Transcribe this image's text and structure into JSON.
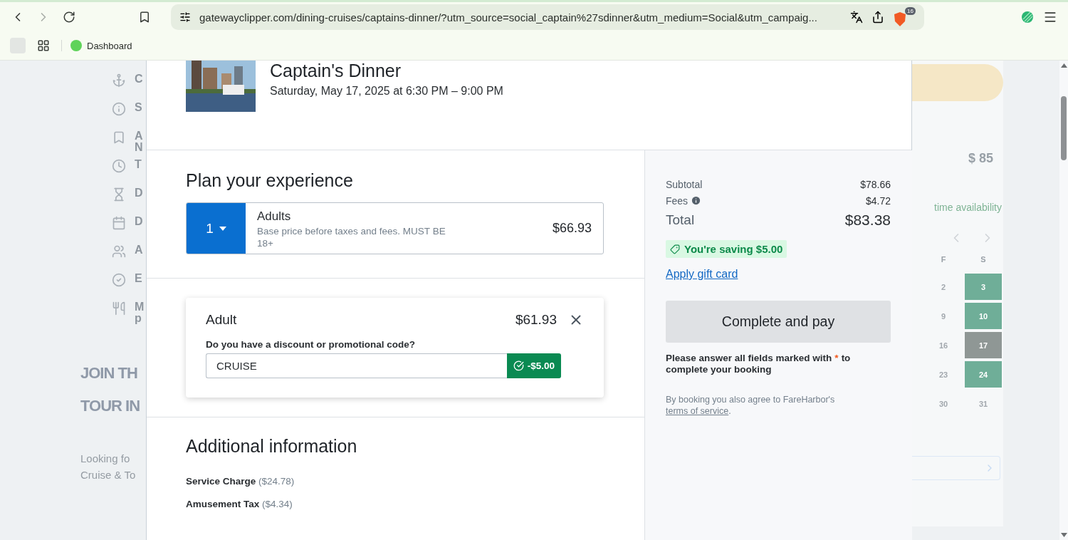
{
  "browser": {
    "url": "gatewayclipper.com/dining-cruises/captains-dinner/?utm_source=social_captain%27sdinner&utm_medium=Social&utm_campaig...",
    "shield_badge": "16",
    "bookmarks": [
      {
        "label": "Dashboard"
      }
    ]
  },
  "background_page": {
    "left_items": [
      {
        "lines": [
          "C"
        ]
      },
      {
        "lines": [
          "S"
        ]
      },
      {
        "lines": [
          "A",
          "N"
        ]
      },
      {
        "lines": [
          "T"
        ]
      },
      {
        "lines": [
          "D"
        ]
      },
      {
        "lines": [
          "D"
        ]
      },
      {
        "lines": [
          "A"
        ]
      },
      {
        "lines": [
          "E"
        ]
      },
      {
        "lines": [
          "M",
          "p"
        ]
      }
    ],
    "headline": [
      "JOIN TH",
      "TOUR IN"
    ],
    "intro": [
      "Looking fo",
      "Cruise & To"
    ],
    "price": "$ 85",
    "availability": "time availability",
    "calendar": {
      "headers": [
        "F",
        "S"
      ],
      "rows": [
        {
          "days": [
            {
              "day": "2",
              "available": false,
              "selected": false
            },
            {
              "day": "3",
              "available": true,
              "selected": false
            }
          ]
        },
        {
          "days": [
            {
              "day": "9",
              "available": false,
              "selected": false
            },
            {
              "day": "10",
              "available": true,
              "selected": false
            }
          ]
        },
        {
          "days": [
            {
              "day": "16",
              "available": false,
              "selected": false
            },
            {
              "day": "17",
              "available": true,
              "selected": true
            }
          ]
        },
        {
          "days": [
            {
              "day": "23",
              "available": false,
              "selected": false
            },
            {
              "day": "24",
              "available": true,
              "selected": false
            }
          ]
        },
        {
          "days": [
            {
              "day": "30",
              "available": false,
              "selected": false
            },
            {
              "day": "31",
              "available": false,
              "selected": false
            }
          ]
        }
      ]
    }
  },
  "event": {
    "title": "Captain's Dinner",
    "datetime": "Saturday, May 17, 2025 at 6:30 PM – 9:00 PM"
  },
  "plan": {
    "heading": "Plan your experience",
    "tickets": [
      {
        "quantity": "1",
        "name": "Adults",
        "description": "Base price before taxes and fees. MUST BE 18+",
        "price": "$66.93"
      }
    ]
  },
  "guest_cards": [
    {
      "title": "Adult",
      "price": "$61.93",
      "promo_label": "Do you have a discount or promotional code?",
      "promo_value": "CRUISE",
      "promo_applied": true,
      "discount": "-$5.00"
    }
  ],
  "additional": {
    "heading": "Additional information",
    "items": [
      {
        "name": "Service Charge",
        "amount": "($24.78)"
      },
      {
        "name": "Amusement Tax",
        "amount": "($4.34)"
      }
    ]
  },
  "summary": {
    "lines": [
      {
        "label": "Subtotal",
        "value": "$78.66",
        "kind": "plain"
      },
      {
        "label": "Fees",
        "value": "$4.72",
        "kind": "info"
      },
      {
        "label": "Total",
        "value": "$83.38",
        "kind": "total"
      }
    ],
    "savings": "You're saving $5.00",
    "gift_card_link": "Apply gift card",
    "pay_button": {
      "label": "Complete and pay",
      "disabled": true
    },
    "required_note": {
      "before": "Please answer all fields marked with",
      "mark": "*",
      "after": "to complete your booking"
    },
    "terms": {
      "text": "By booking you also agree to FareHarbor's",
      "link": "terms of service",
      "end": "."
    }
  }
}
